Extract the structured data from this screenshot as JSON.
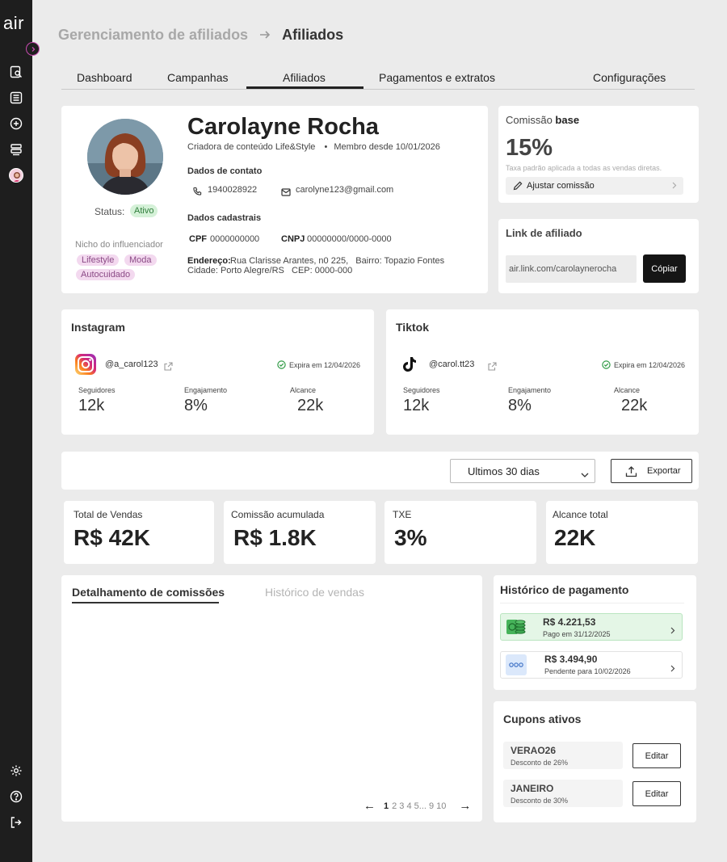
{
  "sidebar": {
    "logo": "air"
  },
  "header": {
    "breadcrumb_parent": "Gerenciamento de afiliados",
    "breadcrumb_current": "Afiliados"
  },
  "tabs": [
    "Dashboard",
    "Campanhas",
    "Afiliados",
    "Pagamentos e extratos",
    "Configurações"
  ],
  "profile": {
    "name": "Carolayne Rocha",
    "role": "Criadora de conteúdo Life&Style",
    "member_since": "Membro desde 10/01/2026",
    "status_label": "Status:",
    "status_value": "Ativo",
    "niche_title": "Nicho do influenciador",
    "niches": [
      "Lifestyle",
      "Moda",
      "Autocuidado"
    ],
    "contact_title": "Dados de contato",
    "phone": "1940028922",
    "email": "carolyne123@gmail.com",
    "registration_title": "Dados cadastrais",
    "cpf_label": "CPF",
    "cpf_value": "0000000000",
    "cnpj_label": "CNPJ",
    "cnpj_value": "00000000/0000-0000",
    "address_label": "Endereço:",
    "address_value": "Rua Clarisse Arantes, n0 225,   Bairro: Topazio Fontes",
    "address_line2": "Cidade: Porto Alegre/RS   CEP: 0000-000"
  },
  "commission": {
    "title_prefix": "Comissão",
    "title_bold": "base",
    "value": "15%",
    "description": "Taxa padrão aplicada a todas as vendas diretas.",
    "adjust_label": "Ajustar comissão"
  },
  "affiliate_link": {
    "title": "Link de afiliado",
    "url": "air.link.com/carolaynerocha",
    "copy_label": "Cópiar"
  },
  "instagram": {
    "title": "Instagram",
    "handle": "@a_carol123",
    "expires": "Expira em 12/04/2026",
    "stats": [
      {
        "label": "Seguidores",
        "value": "12k"
      },
      {
        "label": "Engajamento",
        "value": "8%"
      },
      {
        "label": "Alcance",
        "value": "22k"
      }
    ]
  },
  "tiktok": {
    "title": "Tiktok",
    "handle": "@carol.tt23",
    "expires": "Expira em 12/04/2026",
    "stats": [
      {
        "label": "Seguidores",
        "value": "12k"
      },
      {
        "label": "Engajamento",
        "value": "8%"
      },
      {
        "label": "Alcance",
        "value": "22k"
      }
    ]
  },
  "filters": {
    "period": "Ultimos 30 dias",
    "export_label": "Exportar"
  },
  "kpis": [
    {
      "label": "Total de Vendas",
      "value": "R$ 42K"
    },
    {
      "label": "Comissão acumulada",
      "value": "R$ 1.8K"
    },
    {
      "label": "TXE",
      "value": "3%"
    },
    {
      "label": "Alcance total",
      "value": "22K"
    }
  ],
  "details": {
    "tab_active": "Detalhamento de comissões",
    "tab_inactive": "Histórico de vendas",
    "pagination": {
      "prev": "←",
      "next": "→",
      "current": "1",
      "pages": "2 3 4 5... 9 10"
    }
  },
  "payments": {
    "title": "Histórico de pagamento",
    "items": [
      {
        "amount": "R$ 4.221,53",
        "subtitle": "Pago em 31/12/2025",
        "status_color": "#e4f6e6"
      },
      {
        "amount": "R$ 3.494,90",
        "subtitle": "Pendente para 10/02/2026",
        "status_color": "#ffffff"
      }
    ]
  },
  "coupons": {
    "title": "Cupons ativos",
    "edit_label": "Editar",
    "items": [
      {
        "code": "VERAO26",
        "description": "Desconto de 26%"
      },
      {
        "code": "JANEIRO",
        "description": "Desconto de 30%"
      }
    ]
  }
}
